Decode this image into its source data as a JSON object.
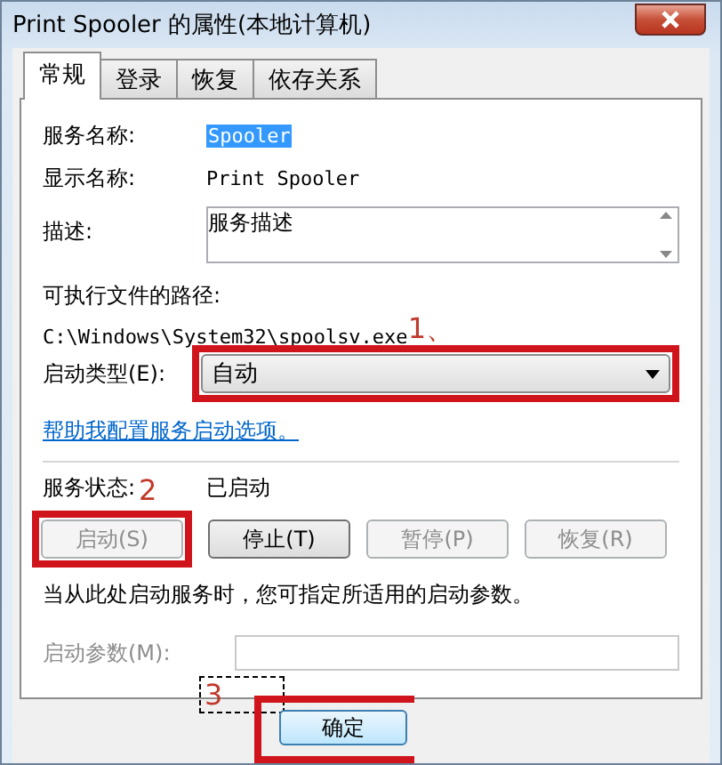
{
  "window": {
    "title": "Print Spooler 的属性(本地计算机)"
  },
  "tabs": [
    {
      "label": "常规",
      "selected": true
    },
    {
      "label": "登录",
      "selected": false
    },
    {
      "label": "恢复",
      "selected": false
    },
    {
      "label": "依存关系",
      "selected": false
    }
  ],
  "fields": [
    {
      "label": "服务名称:",
      "value": "Spooler",
      "selected": true
    },
    {
      "label": "显示名称:",
      "value": "Print Spooler",
      "selected": false
    }
  ],
  "description": {
    "label": "描述:",
    "value": "服务描述"
  },
  "executable": {
    "label": "可执行文件的路径:",
    "path": "C:\\Windows\\System32\\spoolsv.exe"
  },
  "startup_type": {
    "label": "启动类型(E):",
    "value": "自动"
  },
  "help_link": "帮助我配置服务启动选项。",
  "service_status": {
    "label": "服务状态:",
    "value": "已启动"
  },
  "service_buttons": [
    {
      "label": "启动(S)",
      "disabled": true
    },
    {
      "label": "停止(T)",
      "disabled": false
    },
    {
      "label": "暂停(P)",
      "disabled": true
    },
    {
      "label": "恢复(R)",
      "disabled": true
    }
  ],
  "hint": "当从此处启动服务时，您可指定所适用的启动参数。",
  "start_parameters": {
    "label": "启动参数(M):",
    "disabled": true
  },
  "annotations": [
    {
      "label": "1、"
    },
    {
      "label": "2"
    },
    {
      "label": "3"
    }
  ],
  "buttons": [
    {
      "label": "确定"
    }
  ]
}
